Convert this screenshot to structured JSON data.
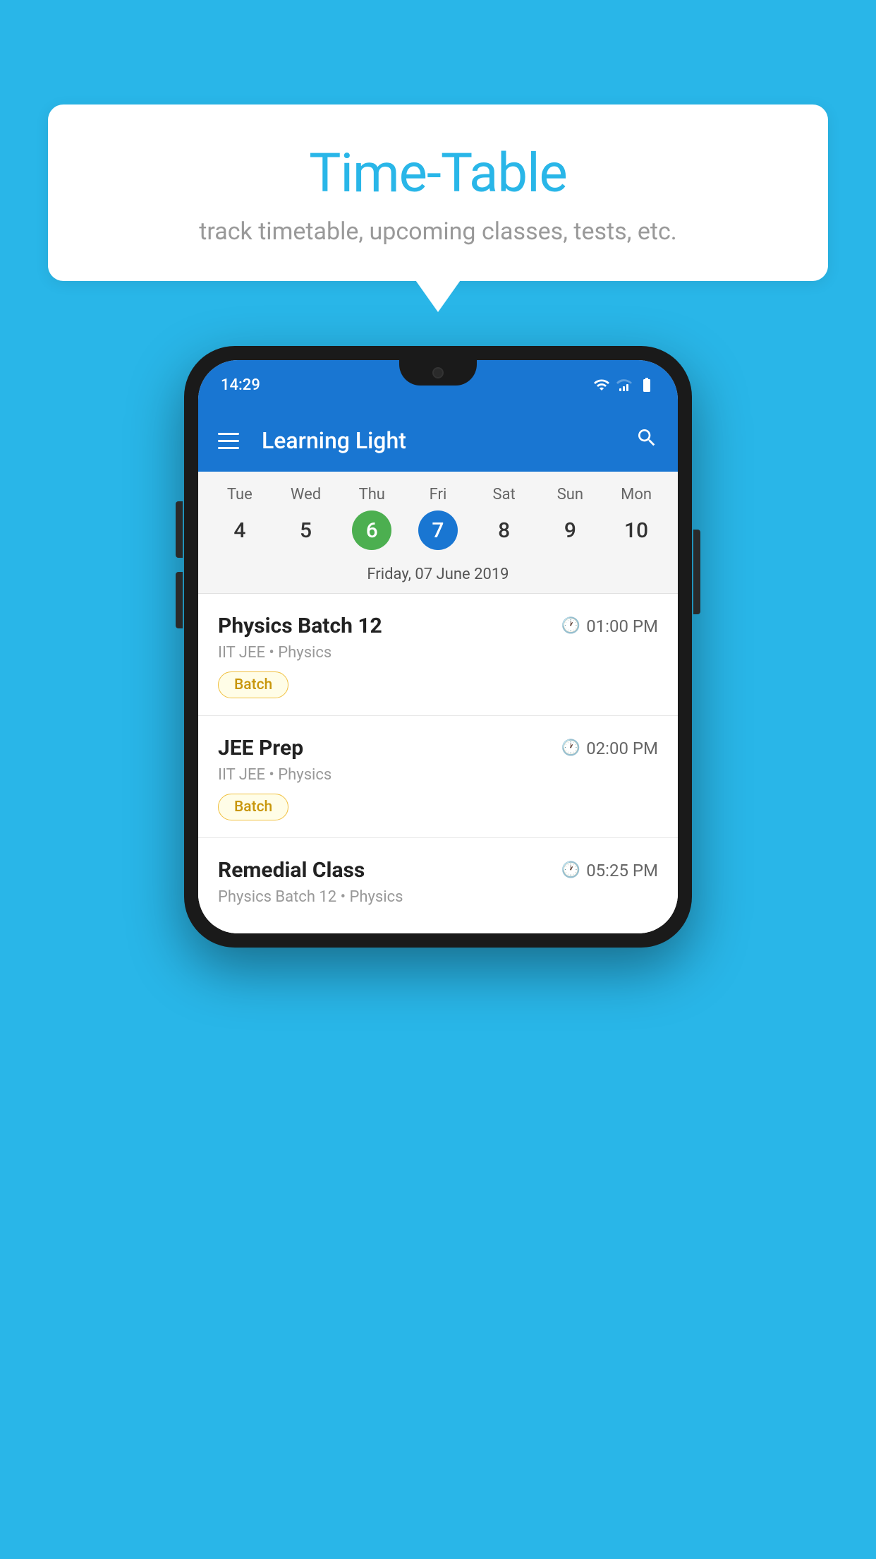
{
  "background_color": "#29b6e8",
  "bubble": {
    "title": "Time-Table",
    "subtitle": "track timetable, upcoming classes, tests, etc."
  },
  "status_bar": {
    "time": "14:29"
  },
  "app_bar": {
    "title": "Learning Light"
  },
  "calendar": {
    "days": [
      {
        "name": "Tue",
        "num": "4",
        "state": "normal"
      },
      {
        "name": "Wed",
        "num": "5",
        "state": "normal"
      },
      {
        "name": "Thu",
        "num": "6",
        "state": "today"
      },
      {
        "name": "Fri",
        "num": "7",
        "state": "selected"
      },
      {
        "name": "Sat",
        "num": "8",
        "state": "normal"
      },
      {
        "name": "Sun",
        "num": "9",
        "state": "normal"
      },
      {
        "name": "Mon",
        "num": "10",
        "state": "normal"
      }
    ],
    "selected_date_label": "Friday, 07 June 2019"
  },
  "schedule": [
    {
      "title": "Physics Batch 12",
      "time": "01:00 PM",
      "subtitle": "IIT JEE • Physics",
      "badge": "Batch"
    },
    {
      "title": "JEE Prep",
      "time": "02:00 PM",
      "subtitle": "IIT JEE • Physics",
      "badge": "Batch"
    },
    {
      "title": "Remedial Class",
      "time": "05:25 PM",
      "subtitle": "Physics Batch 12 • Physics",
      "badge": null
    }
  ]
}
